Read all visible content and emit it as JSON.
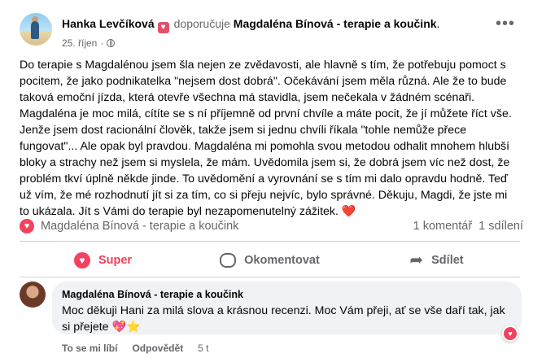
{
  "post": {
    "author": "Hanka Levčíková",
    "verb": "doporučuje",
    "page": "Magdaléna Bínová - terapie a koučink",
    "page_suffix": ".",
    "date": "25. říjen",
    "more_label": "•••",
    "body_text": "Do terapie s Magdalénou jsem šla nejen ze zvědavosti, ale hlavně s tím, že potřebuju pomoct s pocitem, že jako podnikatelka \"nejsem dost dobrá\". Očekávání jsem měla různá. Ale že to bude taková emoční jízda, která otevře všechna má stavidla, jsem nečekala v žádném scénaři. Magdaléna je moc milá, cítíte se s ní příjemně od první chvíle a máte pocit, že jí můžete říct vše. Jenže jsem dost racionální člověk, takže jsem si jednu chvíli říkala \"tohle nemůže přece fungovat\"... Ale opak byl pravdou. Magdaléna mi pomohla svou metodou odhalit mnohem hlubší bloky a strachy než jsem si myslela, že mám. Uvědomila jsem si, že dobrá jsem víc než dost, že problém tkví úplně někde jinde. To uvědomění a vyrovnání se s tím mi dalo opravdu hodně. Teď už vím, že mé rozhodnutí jít si za tím, co si přeju nejvíc, bylo správné. Děkuju, Magdi, že jste mi to ukázala. Jít s Vámi do terapie byl nezapomenutelný zážitek.",
    "body_emoji": "❤️"
  },
  "stats": {
    "reacted_by": "Magdaléna Bínová - terapie a koučink",
    "comments": "1 komentář",
    "shares": "1 sdílení"
  },
  "actions": {
    "like": "Super",
    "comment": "Okomentovat",
    "share": "Sdílet"
  },
  "comment": {
    "author": "Magdaléna Bínová - terapie a koučink",
    "text": "Moc děkuji Hani za milá slova a krásnou recenzi. Moc Vám přeji, ať se vše daří tak, jak si přejete",
    "emoji": "💖⭐",
    "like_label": "To se mi líbí",
    "reply_label": "Odpovědět",
    "time": "5 t"
  },
  "colors": {
    "love": "#f3425f",
    "secondary_text": "#65676b",
    "bubble": "#f0f2f5"
  },
  "icons": {
    "badge": "heart-badge-icon",
    "privacy": "globe-icon",
    "reaction": "love-reaction-icon",
    "comment": "comment-icon",
    "share": "share-arrow-icon"
  }
}
